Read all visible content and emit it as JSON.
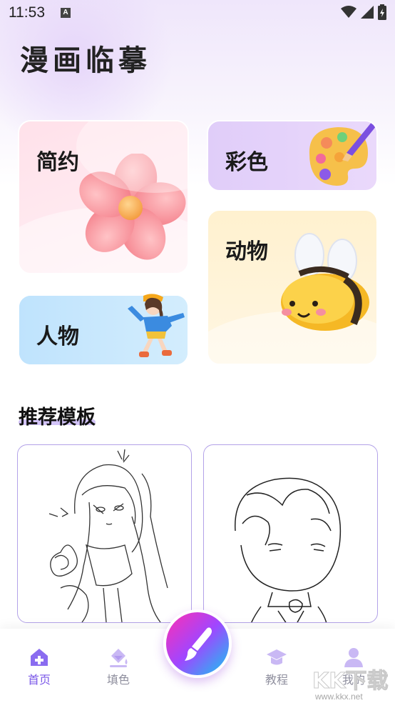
{
  "status_bar": {
    "time": "11:53",
    "notification_glyph": "A"
  },
  "app": {
    "title": "漫画临摹"
  },
  "categories": {
    "simple": "简约",
    "color": "彩色",
    "animal": "动物",
    "person": "人物"
  },
  "section": {
    "title": "推荐模板"
  },
  "templates": [
    {
      "name": "anime-girl-sketch"
    },
    {
      "name": "chibi-boy-sketch"
    }
  ],
  "bottom_nav": {
    "home": "首页",
    "fill": "填色",
    "tutorial": "教程",
    "mine": "我的"
  },
  "watermark": {
    "brand": "KK下载",
    "url": "www.kkx.net"
  },
  "colors": {
    "accent": "#7b58e8",
    "inactive": "#8f8f9e"
  }
}
